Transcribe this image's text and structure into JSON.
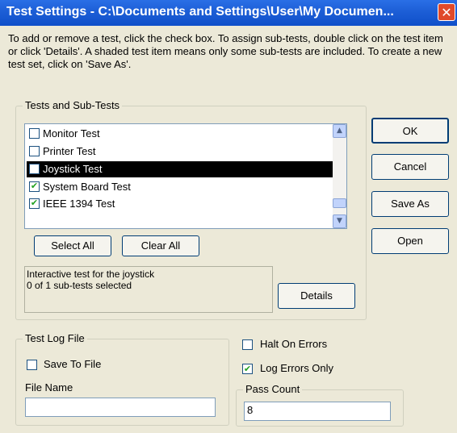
{
  "window": {
    "title": "Test Settings - C:\\Documents and Settings\\User\\My Documen...",
    "close_glyph": "✕"
  },
  "instructions": "To add or remove a test, click the check box. To assign sub-tests, double click on the test item or click 'Details'. A shaded test item means only some sub-tests are included.  To create a new test set, click on 'Save As'.",
  "tests_group": {
    "legend": "Tests and Sub-Tests",
    "items": [
      {
        "label": "Monitor Test",
        "checked": false,
        "selected": false
      },
      {
        "label": "Printer Test",
        "checked": false,
        "selected": false
      },
      {
        "label": "Joystick Test",
        "checked": false,
        "selected": true
      },
      {
        "label": "System Board Test",
        "checked": true,
        "selected": false
      },
      {
        "label": "IEEE 1394 Test",
        "checked": true,
        "selected": false
      }
    ],
    "select_all_label": "Select All",
    "clear_all_label": "Clear All",
    "info_line1": "Interactive test for the joystick",
    "info_line2": "0 of 1 sub-tests selected",
    "details_label": "Details"
  },
  "side_buttons": {
    "ok": "OK",
    "cancel": "Cancel",
    "save_as": "Save As",
    "open": "Open"
  },
  "log_group": {
    "legend": "Test Log File",
    "save_to_file_label": "Save To File",
    "save_to_file_checked": false,
    "file_name_label": "File Name",
    "file_name_value": ""
  },
  "options": {
    "halt_on_errors_label": "Halt On Errors",
    "halt_on_errors_checked": false,
    "log_errors_only_label": "Log Errors Only",
    "log_errors_only_checked": true,
    "pass_count_legend": "Pass Count",
    "pass_count_value": "8"
  },
  "check_glyph": "✔"
}
